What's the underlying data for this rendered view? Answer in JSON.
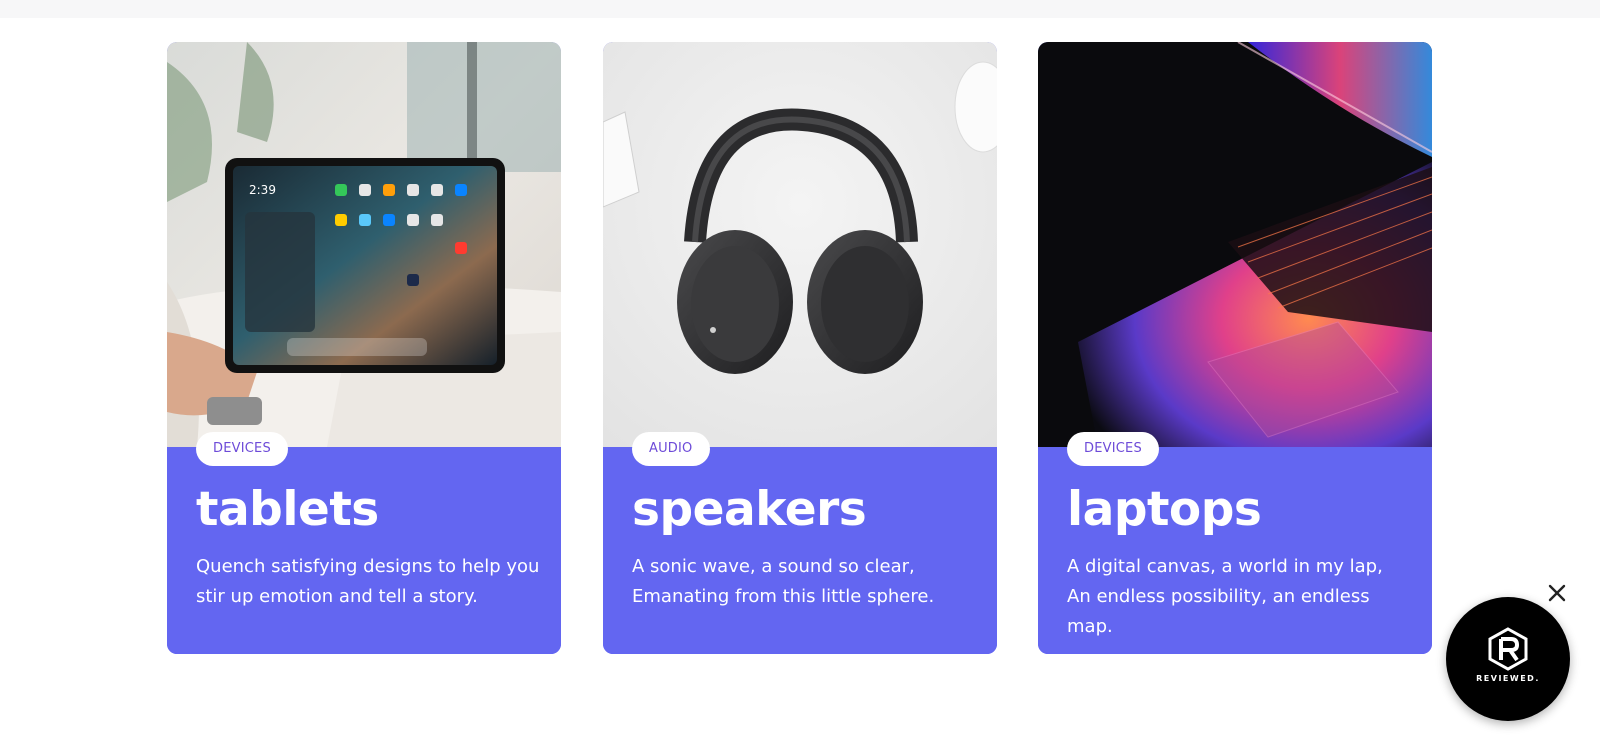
{
  "cards": [
    {
      "badge": "DEVICES",
      "title": "tablets",
      "description": "Quench satisfying designs to help you stir up emotion and tell a story.",
      "image": "tablet-photo"
    },
    {
      "badge": "AUDIO",
      "title": "speakers",
      "description": "A sonic wave, a sound so clear, Emanating from this little sphere.",
      "image": "headphones-photo"
    },
    {
      "badge": "DEVICES",
      "title": "laptops",
      "description": "A digital canvas, a world in my lap, An endless possibility, an endless map.",
      "image": "laptop-photo"
    }
  ],
  "widget": {
    "label": "REVIEWED.",
    "close_icon": "close-icon"
  },
  "colors": {
    "card_accent": "#6366f1",
    "badge_text": "#6d4bd8",
    "widget_bg": "#000000"
  }
}
